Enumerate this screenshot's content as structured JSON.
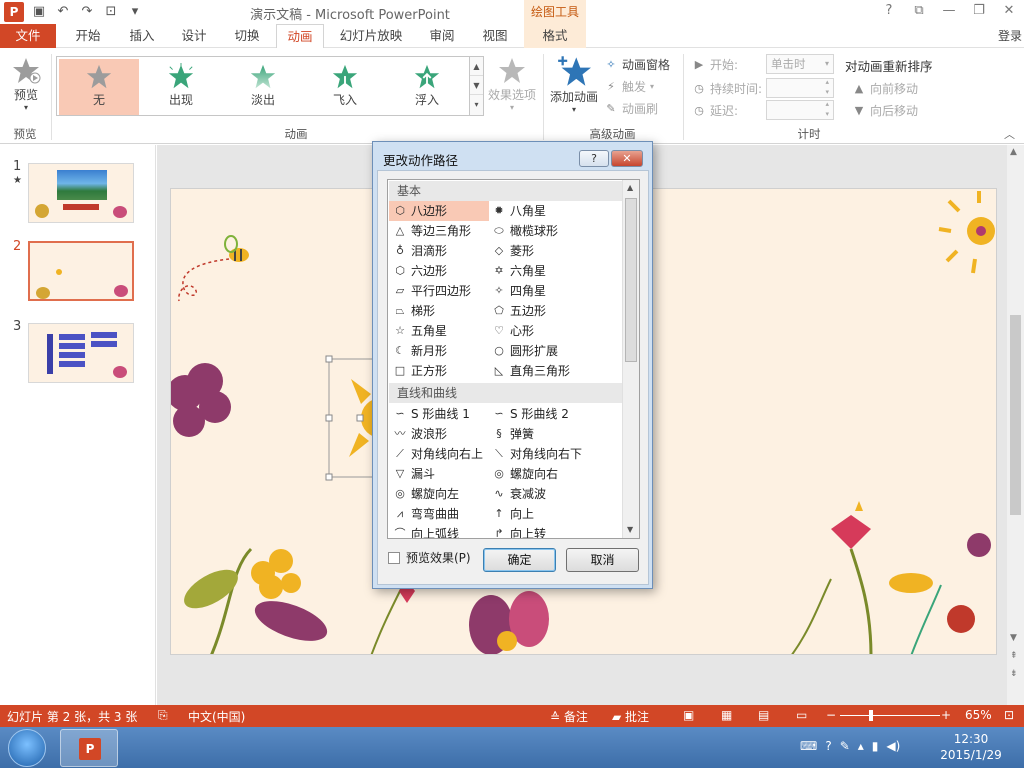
{
  "titlebar": {
    "title": "演示文稿 - Microsoft PowerPoint",
    "context_tab_group": "绘图工具",
    "app_icon": "P"
  },
  "tabs": [
    "文件",
    "开始",
    "插入",
    "设计",
    "切换",
    "动画",
    "幻灯片放映",
    "审阅",
    "视图",
    "格式"
  ],
  "sign_in": "登录",
  "ribbon": {
    "preview_label": "预览",
    "preview_group": "预览",
    "animations": [
      "无",
      "出现",
      "淡出",
      "飞入",
      "浮入"
    ],
    "effect_options": "效果选项",
    "animation_group": "动画",
    "add_animation": "添加动画",
    "animation_pane": "动画窗格",
    "trigger": "触发",
    "animation_painter": "动画刷",
    "advanced_group": "高级动画",
    "start_label": "开始:",
    "start_value": "单击时",
    "duration_label": "持续时间:",
    "delay_label": "延迟:",
    "timing_group": "计时",
    "reorder_title": "对动画重新排序",
    "move_earlier": "向前移动",
    "move_later": "向后移动"
  },
  "slides": [
    {
      "num": "1",
      "star": "★"
    },
    {
      "num": "2"
    },
    {
      "num": "3"
    }
  ],
  "dialog": {
    "title": "更改动作路径",
    "help": "?",
    "close": "✕",
    "cat_basic": "基本",
    "basic_items": [
      "八边形",
      "八角星",
      "等边三角形",
      "橄榄球形",
      "泪滴形",
      "菱形",
      "六边形",
      "六角星",
      "平行四边形",
      "四角星",
      "梯形",
      "五边形",
      "五角星",
      "心形",
      "新月形",
      "圆形扩展",
      "正方形",
      "直角三角形"
    ],
    "cat_lines": "直线和曲线",
    "line_items": [
      "S 形曲线 1",
      "S 形曲线 2",
      "波浪形",
      "弹簧",
      "对角线向右上",
      "对角线向右下",
      "漏斗",
      "螺旋向右",
      "螺旋向左",
      "衰减波",
      "弯弯曲曲",
      "向上",
      "向上弧线",
      "向上转"
    ],
    "selected": "八边形",
    "preview_checkbox": "预览效果(P)",
    "ok": "确定",
    "cancel": "取消"
  },
  "statusbar": {
    "slide_info": "幻灯片 第 2 张，共 3 张",
    "language": "中文(中国)",
    "notes": "备注",
    "comments": "批注",
    "zoom": "65%",
    "zoom_fraction": 0.65
  },
  "taskbar": {
    "time": "12:30",
    "date": "2015/1/29"
  },
  "colors": {
    "accent": "#d24726",
    "selection": "#f9c9b5",
    "slide_bg": "#fdf1e2",
    "star_green": "#3aa57a",
    "star_gray": "#9c9c9c"
  }
}
